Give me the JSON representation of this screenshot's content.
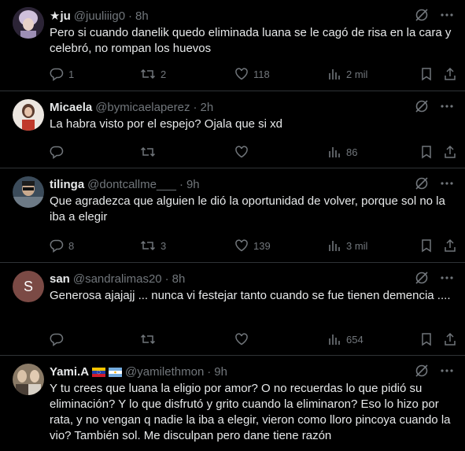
{
  "tweets": [
    {
      "name": "★ju",
      "handle": "@juuliiig0",
      "time": "8h",
      "text": "Pero si cuando danelik quedo eliminada luana se le cagó de risa en la cara y celebró, no rompan los huevos",
      "replies": "1",
      "retweets": "2",
      "likes": "118",
      "views": "2 mil",
      "avatar_color": "#c7b7d4"
    },
    {
      "name": "Micaela",
      "handle": "@bymicaelaperez",
      "time": "2h",
      "text": "La habra visto por el espejo? Ojala que si xd",
      "replies": "",
      "retweets": "",
      "likes": "",
      "views": "86",
      "avatar_color": "#e9e2dc"
    },
    {
      "name": "tilinga",
      "handle": "@dontcallme___",
      "time": "9h",
      "text": "Que agradezca que alguien le dió la oportunidad de volver, porque sol no la iba a elegir",
      "replies": "8",
      "retweets": "3",
      "likes": "139",
      "views": "3 mil",
      "avatar_color": "#5b6a78"
    },
    {
      "name": "san",
      "handle": "@sandralimas20",
      "time": "8h",
      "text": "Generosa ajajajj ... nunca vi festejar tanto cuando se fue tienen demencia ....",
      "replies": "",
      "retweets": "",
      "likes": "",
      "views": "654",
      "avatar_letter": "S",
      "avatar_color": "#7b4a45"
    },
    {
      "name": "Yami.A",
      "handle": "@yamilethmon",
      "time": "9h",
      "text": "Y tu crees que luana la eligio por amor? O no recuerdas lo que pidió su eliminación? Y lo que disfrutó y grito cuando la eliminaron? Eso lo hizo por rata, y no vengan q nadie la iba a elegir, vieron como lloro pincoya cuando la vio? También sol. Me disculpan pero dane tiene razón",
      "avatar_color": "#a08a70"
    }
  ],
  "dot": "·",
  "colors": {
    "text": "#e7e9ea",
    "muted": "#71767b",
    "divider": "#2f3336"
  }
}
